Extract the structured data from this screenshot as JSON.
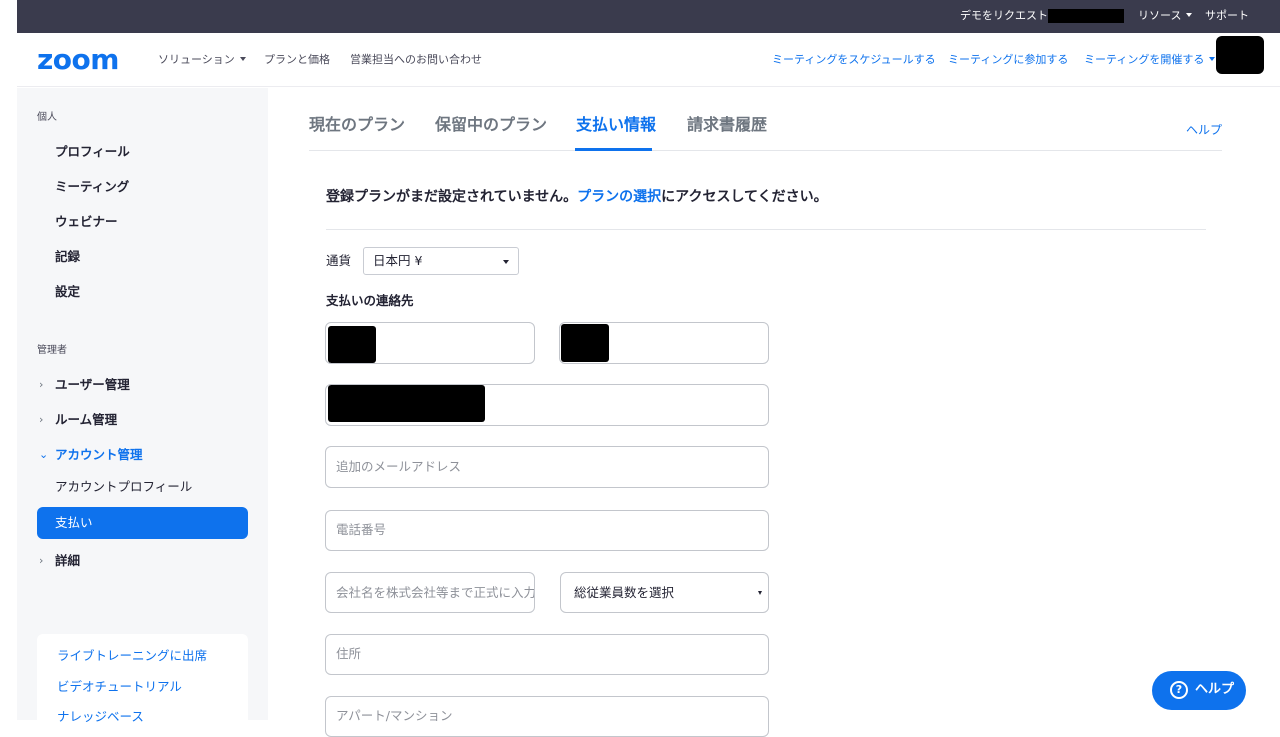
{
  "topbar": {
    "request_demo": "デモをリクエスト",
    "resources": "リソース",
    "support": "サポート"
  },
  "header": {
    "logo": "zoom",
    "nav_solutions": "ソリューション",
    "nav_plans": "プランと価格",
    "nav_contact_sales": "営業担当へのお問い合わせ",
    "schedule_meeting": "ミーティングをスケジュールする",
    "join_meeting": "ミーティングに参加する",
    "host_meeting": "ミーティングを開催する"
  },
  "sidebar": {
    "personal_heading": "個人",
    "personal_items": [
      "プロフィール",
      "ミーティング",
      "ウェビナー",
      "記録",
      "設定"
    ],
    "admin_heading": "管理者",
    "user_management": "ユーザー管理",
    "room_management": "ルーム管理",
    "account_management": "アカウント管理",
    "account_profile": "アカウントプロフィール",
    "billing": "支払い",
    "advanced": "詳細",
    "resource_links": [
      "ライブトレーニングに出席",
      "ビデオチュートリアル",
      "ナレッジベース"
    ]
  },
  "tabs": {
    "current_plans": "現在のプラン",
    "pending_plans": "保留中のプラン",
    "billing_info": "支払い情報",
    "invoice_history": "請求書履歴",
    "help": "ヘルプ"
  },
  "notice": {
    "prefix": "登録プランがまだ設定されていません。",
    "link": "プランの選択",
    "suffix": "にアクセスしてください。"
  },
  "form": {
    "currency_label": "通貨",
    "currency_value": "日本円 ¥",
    "contact_heading": "支払いの連絡先",
    "additional_email_placeholder": "追加のメールアドレス",
    "phone_placeholder": "電話番号",
    "company_placeholder": "会社名を株式会社等まで正式に入力く",
    "employee_count_select": "総従業員数を選択",
    "address_placeholder": "住所",
    "apartment_placeholder": "アパート/マンション"
  },
  "help_button": {
    "icon": "?",
    "label": "ヘルプ"
  },
  "colors": {
    "accent": "#0e72ed",
    "topbar": "#3a3b4d",
    "sidebar_bg": "#f6f7f9"
  }
}
